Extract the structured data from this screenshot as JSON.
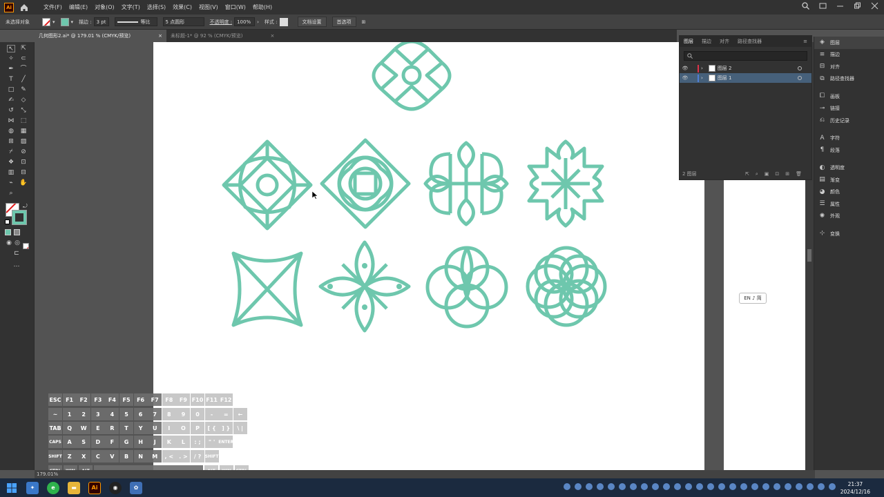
{
  "app": {
    "logo": "Ai",
    "menus": [
      "文件(F)",
      "编辑(E)",
      "对象(O)",
      "文字(T)",
      "选择(S)",
      "效果(C)",
      "视图(V)",
      "窗口(W)",
      "帮助(H)"
    ]
  },
  "control_bar": {
    "selection_state": "未选择对象",
    "stroke_label": "描边 :",
    "stroke_value": "3 pt",
    "stroke_profile": "等比",
    "brush_value": "5 点圆形",
    "opacity_label": "不透明度 :",
    "opacity_value": "100%",
    "style_label": "样式 :",
    "doc_setup_label": "文档设置",
    "preferences_label": "首选项"
  },
  "tabs": [
    {
      "label": "几何图形2.ai* @ 179.01 % (CMYK/预览)",
      "active": true
    },
    {
      "label": "未标题-1* @ 92 % (CMYK/预览)",
      "active": false
    }
  ],
  "layers_panel": {
    "tabs": [
      "图层",
      "描边",
      "对齐",
      "路径查找器"
    ],
    "layers": [
      {
        "name": "图层 2",
        "color": "#e0334a",
        "selected": false
      },
      {
        "name": "图层 1",
        "color": "#4f7fd6",
        "selected": true
      }
    ],
    "footer_count": "2 图层"
  },
  "dock": {
    "items": [
      {
        "label": "图层",
        "icon": "layers-icon",
        "active": true
      },
      {
        "label": "描边",
        "icon": "stroke-icon"
      },
      {
        "label": "对齐",
        "icon": "align-icon"
      },
      {
        "label": "路径查找器",
        "icon": "pathfinder-icon"
      },
      {
        "label": "画板",
        "icon": "artboard-icon"
      },
      {
        "label": "链接",
        "icon": "link-icon"
      },
      {
        "label": "历史记录",
        "icon": "history-icon"
      },
      {
        "label": "字符",
        "icon": "character-icon"
      },
      {
        "label": "段落",
        "icon": "paragraph-icon"
      },
      {
        "label": "透明度",
        "icon": "transparency-icon"
      },
      {
        "label": "渐变",
        "icon": "gradient-icon"
      },
      {
        "label": "颜色",
        "icon": "color-icon"
      },
      {
        "label": "属性",
        "icon": "properties-icon"
      },
      {
        "label": "外观",
        "icon": "appearance-icon"
      },
      {
        "label": "变换",
        "icon": "transform-icon"
      }
    ]
  },
  "ime_badge": "EN ♪ 简",
  "status": {
    "zoom": "179.01%"
  },
  "keyboard": {
    "row1": [
      "ESC",
      "F1",
      "F2",
      "F3",
      "F4",
      "F5",
      "F6",
      "F7",
      "F8",
      "F9",
      "F10",
      "F11",
      "F12"
    ],
    "row2": [
      "~",
      "1",
      "2",
      "3",
      "4",
      "5",
      "6",
      "7",
      "8",
      "9",
      "0",
      "-",
      "=",
      "←"
    ],
    "row3": [
      "TAB",
      "Q",
      "W",
      "E",
      "R",
      "T",
      "Y",
      "U",
      "I",
      "O",
      "P",
      "[ {",
      "] }",
      "\\ |"
    ],
    "row4": [
      "CAPS",
      "A",
      "S",
      "D",
      "F",
      "G",
      "H",
      "J",
      "K",
      "L",
      ": ;",
      "\" '",
      "ENTER"
    ],
    "row5": [
      "SHIFT",
      "Z",
      "X",
      "C",
      "V",
      "B",
      "N",
      "M",
      ", <",
      ". >",
      "/ ?",
      "SHIFT"
    ],
    "row6": [
      "CTRL",
      "WIN",
      "ALT",
      "ALT",
      "WIN",
      "CTRL"
    ]
  },
  "taskbar": {
    "time": "21:37",
    "date": "2024/12/16"
  },
  "colors": {
    "accent": "#6ec7ad",
    "ui_dark": "#323232",
    "ui_mid": "#535353"
  }
}
